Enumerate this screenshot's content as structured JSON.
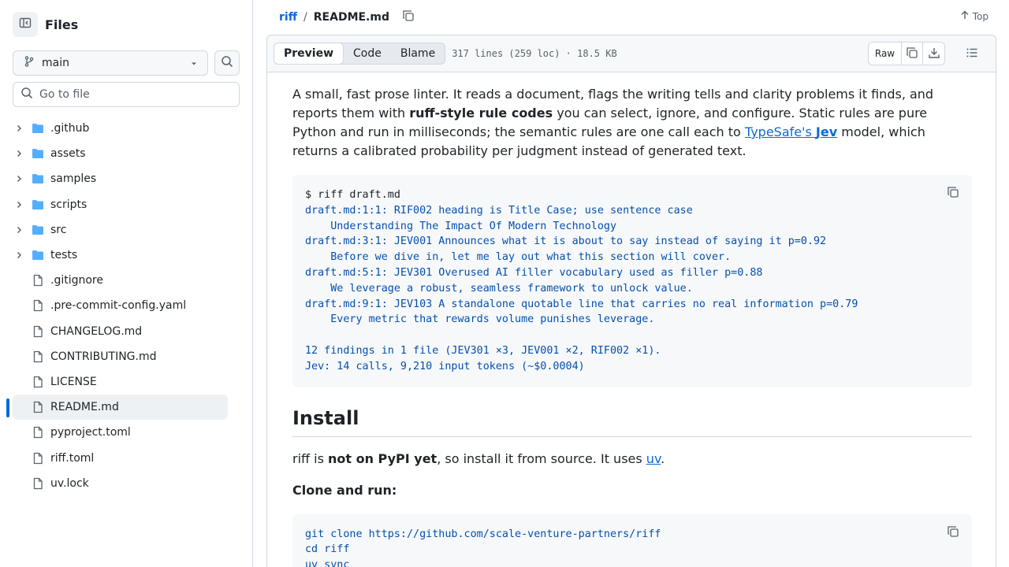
{
  "sidebar": {
    "title": "Files",
    "branch": "main",
    "goto_placeholder": "Go to file",
    "items": [
      {
        "name": ".github",
        "type": "folder"
      },
      {
        "name": "assets",
        "type": "folder"
      },
      {
        "name": "samples",
        "type": "folder"
      },
      {
        "name": "scripts",
        "type": "folder"
      },
      {
        "name": "src",
        "type": "folder"
      },
      {
        "name": "tests",
        "type": "folder"
      },
      {
        "name": ".gitignore",
        "type": "file"
      },
      {
        "name": ".pre-commit-config.yaml",
        "type": "file"
      },
      {
        "name": "CHANGELOG.md",
        "type": "file"
      },
      {
        "name": "CONTRIBUTING.md",
        "type": "file"
      },
      {
        "name": "LICENSE",
        "type": "file"
      },
      {
        "name": "README.md",
        "type": "file",
        "selected": true
      },
      {
        "name": "pyproject.toml",
        "type": "file"
      },
      {
        "name": "riff.toml",
        "type": "file"
      },
      {
        "name": "uv.lock",
        "type": "file"
      }
    ]
  },
  "breadcrumb": {
    "repo": "riff",
    "separator": "/",
    "file": "README.md",
    "top_label": "Top"
  },
  "file_header": {
    "tabs": [
      "Preview",
      "Code",
      "Blame"
    ],
    "active_tab": "Preview",
    "meta": "317 lines (259 loc) · 18.5 KB",
    "raw_label": "Raw"
  },
  "readme": {
    "intro": {
      "t1": "A small, fast prose linter. It reads a document, flags the writing tells and clarity problems it finds, and reports them with ",
      "b1": "ruff-style rule codes",
      "t2": " you can select, ignore, and configure. Static rules are pure Python and run in milliseconds; the semantic rules are one call each to ",
      "link1": "TypeSafe's ",
      "link1_bold": "Jev",
      "t3": " model, which returns a calibrated probability per judgment instead of generated text."
    },
    "code1": {
      "command": "$ riff draft.md",
      "lines": [
        "draft.md:1:1: RIF002 heading is Title Case; use sentence case",
        "    Understanding The Impact Of Modern Technology",
        "draft.md:3:1: JEV001 Announces what it is about to say instead of saying it p=0.92",
        "    Before we dive in, let me lay out what this section will cover.",
        "draft.md:5:1: JEV301 Overused AI filler vocabulary used as filler p=0.88",
        "    We leverage a robust, seamless framework to unlock value.",
        "draft.md:9:1: JEV103 A standalone quotable line that carries no real information p=0.79",
        "    Every metric that rewards volume punishes leverage.",
        "",
        "12 findings in 1 file (JEV301 ×3, JEV001 ×2, RIF002 ×1).",
        "Jev: 14 calls, 9,210 input tokens (~$0.0004)"
      ]
    },
    "install_heading": "Install",
    "install_para": {
      "t1": "riff is ",
      "b1": "not on PyPI yet",
      "t2": ", so install it from source. It uses ",
      "link": "uv",
      "t3": "."
    },
    "clone_heading": "Clone and run:",
    "code2": {
      "lines": [
        "git clone https://github.com/scale-venture-partners/riff",
        "cd riff",
        "uv sync"
      ]
    }
  },
  "colors": {
    "accent": "#0969da",
    "code_text": "#0550ae",
    "border": "#d1d9e0"
  }
}
